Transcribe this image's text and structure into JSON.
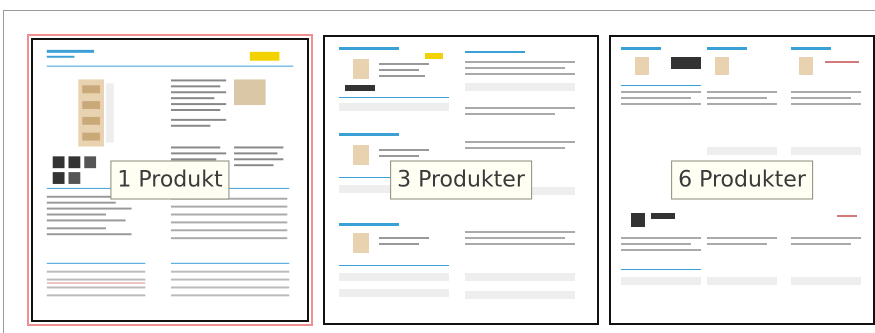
{
  "options": [
    {
      "label": "1 Produkt",
      "selected": true,
      "layout": "one"
    },
    {
      "label": "3 Produkter",
      "selected": false,
      "layout": "three"
    },
    {
      "label": "6 Produkter",
      "selected": false,
      "layout": "six"
    }
  ],
  "colors": {
    "selected_border": "#f08f8f",
    "accent": "#3aa0d6",
    "highlight": "#f2d200"
  }
}
